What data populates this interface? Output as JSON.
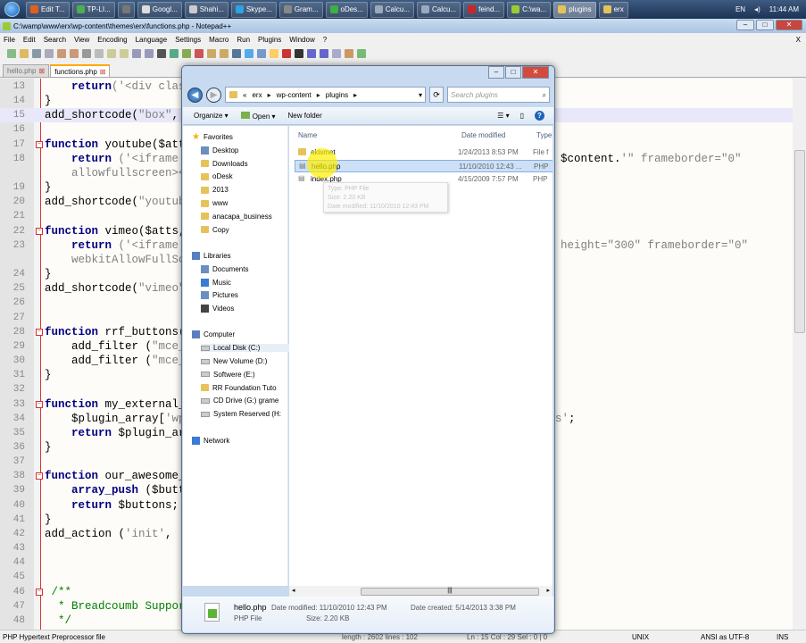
{
  "taskbar": {
    "items": [
      {
        "label": "Edit T...",
        "color": "#e06020"
      },
      {
        "label": "TP-LI...",
        "color": "#4caf50"
      },
      {
        "label": "",
        "color": "#777777"
      },
      {
        "label": "Googl...",
        "color": "#dddddd"
      },
      {
        "label": "Shahi...",
        "color": "#cccccc"
      },
      {
        "label": "Skype...",
        "color": "#2aa5e0"
      },
      {
        "label": "Gram...",
        "color": "#888888"
      },
      {
        "label": "oDes...",
        "color": "#3cb043"
      },
      {
        "label": "Calcu...",
        "color": "#9ab"
      },
      {
        "label": "Calcu...",
        "color": "#9ab"
      },
      {
        "label": "feind...",
        "color": "#c62828"
      },
      {
        "label": "C:\\wa...",
        "color": "#9c3"
      },
      {
        "label": "plugins",
        "color": "#e6c25a",
        "active": true
      },
      {
        "label": "erx",
        "color": "#e6c25a"
      }
    ],
    "lang": "EN",
    "time": "11:44 AM"
  },
  "npp": {
    "title": "C:\\wamp\\www\\erx\\wp-content\\themes\\erx\\functions.php - Notepad++",
    "menu": [
      "File",
      "Edit",
      "Search",
      "View",
      "Encoding",
      "Language",
      "Settings",
      "Macro",
      "Run",
      "Plugins",
      "Window",
      "?"
    ],
    "menu_close": "X",
    "tabs": [
      {
        "label": "hello.php",
        "active": false
      },
      {
        "label": "functions.php",
        "active": true
      }
    ],
    "lines": [
      {
        "n": "13",
        "segs": [
          [
            "pl",
            "    "
          ],
          [
            "kw",
            "return"
          ],
          [
            "str",
            "('<div class"
          ]
        ]
      },
      {
        "n": "14",
        "segs": [
          [
            "pl",
            "}"
          ]
        ]
      },
      {
        "n": "15",
        "cur": true,
        "segs": [
          [
            "pl",
            "add_shortcode("
          ],
          [
            "str",
            "\"box\""
          ],
          [
            "pl",
            ", "
          ]
        ]
      },
      {
        "n": "16",
        "segs": []
      },
      {
        "n": "17",
        "fold": true,
        "segs": [
          [
            "kw",
            "function"
          ],
          [
            "pl",
            " youtube($atts"
          ]
        ]
      },
      {
        "n": "18",
        "segs": [
          [
            "pl",
            "    "
          ],
          [
            "kw",
            "return"
          ],
          [
            "str",
            " ('<iframe "
          ]
        ],
        "right": [
          [
            "pl",
            "$content."
          ],
          [
            "str",
            "'\" frameborder=\"0\""
          ]
        ]
      },
      {
        "n": "",
        "segs": [
          [
            "str",
            "    allowfullscreen></"
          ]
        ]
      },
      {
        "n": "19",
        "segs": [
          [
            "pl",
            "}"
          ]
        ]
      },
      {
        "n": "20",
        "segs": [
          [
            "pl",
            "add_shortcode("
          ],
          [
            "str",
            "\"youtube"
          ]
        ]
      },
      {
        "n": "21",
        "segs": []
      },
      {
        "n": "22",
        "fold": true,
        "segs": [
          [
            "kw",
            "function"
          ],
          [
            "pl",
            " vimeo($atts, "
          ]
        ]
      },
      {
        "n": "23",
        "segs": [
          [
            "pl",
            "    "
          ],
          [
            "kw",
            "return"
          ],
          [
            "str",
            " ('<iframe s"
          ]
        ],
        "right": [
          [
            "str",
            "height=\"300\" frameborder=\"0\""
          ]
        ]
      },
      {
        "n": "",
        "segs": [
          [
            "str",
            "    webkitAllowFullScr"
          ]
        ]
      },
      {
        "n": "24",
        "segs": [
          [
            "pl",
            "}"
          ]
        ]
      },
      {
        "n": "25",
        "segs": [
          [
            "pl",
            "add_shortcode("
          ],
          [
            "str",
            "\"vimeo\""
          ],
          [
            "pl",
            ","
          ]
        ]
      },
      {
        "n": "26",
        "segs": []
      },
      {
        "n": "27",
        "segs": []
      },
      {
        "n": "28",
        "fold": true,
        "segs": [
          [
            "kw",
            "function"
          ],
          [
            "pl",
            " rrf_buttons()"
          ]
        ]
      },
      {
        "n": "29",
        "segs": [
          [
            "pl",
            "    add_filter ("
          ],
          [
            "str",
            "\"mce_e"
          ]
        ]
      },
      {
        "n": "30",
        "segs": [
          [
            "pl",
            "    add_filter ("
          ],
          [
            "str",
            "\"mce_b"
          ]
        ]
      },
      {
        "n": "31",
        "segs": [
          [
            "pl",
            "}"
          ]
        ]
      },
      {
        "n": "32",
        "segs": []
      },
      {
        "n": "33",
        "fold": true,
        "segs": [
          [
            "kw",
            "function"
          ],
          [
            "pl",
            " my_external_p"
          ]
        ]
      },
      {
        "n": "34",
        "segs": [
          [
            "pl",
            "    $plugin_array["
          ],
          [
            "str",
            "'wpt"
          ]
        ],
        "right2": [
          [
            "str",
            "s'"
          ],
          [
            "pl",
            ";"
          ]
        ]
      },
      {
        "n": "35",
        "segs": [
          [
            "pl",
            "    "
          ],
          [
            "kw",
            "return"
          ],
          [
            "pl",
            " $plugin_arr"
          ]
        ]
      },
      {
        "n": "36",
        "segs": [
          [
            "pl",
            "}"
          ]
        ]
      },
      {
        "n": "37",
        "segs": []
      },
      {
        "n": "38",
        "fold": true,
        "segs": [
          [
            "kw",
            "function"
          ],
          [
            "pl",
            " our_awesome_b"
          ]
        ]
      },
      {
        "n": "39",
        "segs": [
          [
            "pl",
            "    "
          ],
          [
            "kw",
            "array_push"
          ],
          [
            "pl",
            " ($butto"
          ]
        ]
      },
      {
        "n": "40",
        "segs": [
          [
            "pl",
            "    "
          ],
          [
            "kw",
            "return"
          ],
          [
            "pl",
            " $buttons;"
          ]
        ]
      },
      {
        "n": "41",
        "segs": [
          [
            "pl",
            "}"
          ]
        ]
      },
      {
        "n": "42",
        "segs": [
          [
            "pl",
            "add_action ("
          ],
          [
            "str",
            "'init'"
          ],
          [
            "pl",
            ", '"
          ]
        ]
      },
      {
        "n": "43",
        "segs": []
      },
      {
        "n": "44",
        "segs": []
      },
      {
        "n": "45",
        "segs": []
      },
      {
        "n": "46",
        "fold": true,
        "segs": [
          [
            "cm",
            " /**"
          ]
        ]
      },
      {
        "n": "47",
        "segs": [
          [
            "cm",
            "  * Breadcoumb Support"
          ]
        ]
      },
      {
        "n": "48",
        "segs": [
          [
            "cm",
            "  */"
          ]
        ]
      }
    ],
    "status": {
      "filetype": "PHP Hypertext Preprocessor file",
      "length": "length : 2602    lines : 102",
      "position": "Ln : 15    Col : 29    Sel : 0 | 0",
      "eol": "UNIX",
      "encoding": "ANSI as UTF-8",
      "mode": "INS"
    }
  },
  "explorer": {
    "path": [
      "«",
      "erx",
      "▸",
      "wp-content",
      "▸",
      "plugins",
      "▸"
    ],
    "search_placeholder": "Search plugins",
    "commands": {
      "organize": "Organize ▾",
      "open": "Open ▾",
      "new_folder": "New folder"
    },
    "nav": [
      {
        "label": "Favorites",
        "type": "head"
      },
      {
        "label": "Desktop"
      },
      {
        "label": "Downloads"
      },
      {
        "label": "oDesk"
      },
      {
        "label": "2013"
      },
      {
        "label": "www"
      },
      {
        "label": "anacapa_business"
      },
      {
        "label": "Copy"
      },
      {
        "label": "Libraries",
        "type": "head"
      },
      {
        "label": "Documents"
      },
      {
        "label": "Music"
      },
      {
        "label": "Pictures"
      },
      {
        "label": "Videos"
      },
      {
        "label": "Computer",
        "type": "head"
      },
      {
        "label": "Local Disk (C:)",
        "sel": true
      },
      {
        "label": "New Volume (D:)"
      },
      {
        "label": "Softwere (E:)"
      },
      {
        "label": "RR Foundation Tuto"
      },
      {
        "label": "CD Drive (G:) grame"
      },
      {
        "label": "System Reserved (H:"
      },
      {
        "label": "Network",
        "type": "head"
      }
    ],
    "columns": {
      "name": "Name",
      "date": "Date modified",
      "type": "Type"
    },
    "files": [
      {
        "name": "akismet",
        "date": "1/24/2013 8:53 PM",
        "type": "File f"
      },
      {
        "name": "hello.php",
        "date": "11/10/2010 12:43 ...",
        "type": "PHP",
        "sel": true
      },
      {
        "name": "index.php",
        "date": "4/15/2009 7:57 PM",
        "type": "PHP"
      }
    ],
    "tooltip": [
      "Type: PHP File",
      "Size: 2.20 KB",
      "Date modified: 11/10/2010 12:43 PM"
    ],
    "details": {
      "name": "hello.php",
      "type": "PHP File",
      "modified": "Date modified: 11/10/2010 12:43 PM",
      "size": "Size: 2.20 KB",
      "created": "Date created: 5/14/2013 3:38 PM"
    }
  }
}
